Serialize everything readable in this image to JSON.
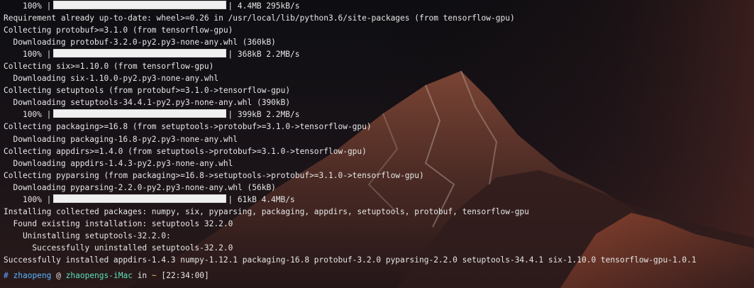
{
  "terminal": {
    "colors": {
      "background": "#101012",
      "text": "#e6e6e6",
      "progress_bar": "#f0f0f0"
    },
    "lines": [
      {
        "kind": "progress",
        "percent": "100%",
        "fill": 1.0,
        "info": "4.4MB 295kB/s"
      },
      {
        "kind": "text",
        "text": "Requirement already up-to-date: wheel>=0.26 in /usr/local/lib/python3.6/site-packages (from tensorflow-gpu)"
      },
      {
        "kind": "text",
        "text": "Collecting protobuf>=3.1.0 (from tensorflow-gpu)"
      },
      {
        "kind": "text",
        "text": "  Downloading protobuf-3.2.0-py2.py3-none-any.whl (360kB)"
      },
      {
        "kind": "progress",
        "percent": "100%",
        "fill": 1.0,
        "info": "368kB 2.2MB/s"
      },
      {
        "kind": "text",
        "text": "Collecting six>=1.10.0 (from tensorflow-gpu)"
      },
      {
        "kind": "text",
        "text": "  Downloading six-1.10.0-py2.py3-none-any.whl"
      },
      {
        "kind": "text",
        "text": "Collecting setuptools (from protobuf>=3.1.0->tensorflow-gpu)"
      },
      {
        "kind": "text",
        "text": "  Downloading setuptools-34.4.1-py2.py3-none-any.whl (390kB)"
      },
      {
        "kind": "progress",
        "percent": "100%",
        "fill": 1.0,
        "info": "399kB 2.2MB/s"
      },
      {
        "kind": "text",
        "text": "Collecting packaging>=16.8 (from setuptools->protobuf>=3.1.0->tensorflow-gpu)"
      },
      {
        "kind": "text",
        "text": "  Downloading packaging-16.8-py2.py3-none-any.whl"
      },
      {
        "kind": "text",
        "text": "Collecting appdirs>=1.4.0 (from setuptools->protobuf>=3.1.0->tensorflow-gpu)"
      },
      {
        "kind": "text",
        "text": "  Downloading appdirs-1.4.3-py2.py3-none-any.whl"
      },
      {
        "kind": "text",
        "text": "Collecting pyparsing (from packaging>=16.8->setuptools->protobuf>=3.1.0->tensorflow-gpu)"
      },
      {
        "kind": "text",
        "text": "  Downloading pyparsing-2.2.0-py2.py3-none-any.whl (56kB)"
      },
      {
        "kind": "progress",
        "percent": "100%",
        "fill": 1.0,
        "info": "61kB 4.4MB/s"
      },
      {
        "kind": "text",
        "text": "Installing collected packages: numpy, six, pyparsing, packaging, appdirs, setuptools, protobuf, tensorflow-gpu"
      },
      {
        "kind": "text",
        "text": "  Found existing installation: setuptools 32.2.0"
      },
      {
        "kind": "text",
        "text": "    Uninstalling setuptools-32.2.0:"
      },
      {
        "kind": "text",
        "text": "      Successfully uninstalled setuptools-32.2.0"
      },
      {
        "kind": "text",
        "text": "Successfully installed appdirs-1.4.3 numpy-1.12.1 packaging-16.8 protobuf-3.2.0 pyparsing-2.2.0 setuptools-34.4.1 six-1.10.0 tensorflow-gpu-1.0.1"
      }
    ],
    "prompt": {
      "hash": "#",
      "user": "zhaopeng",
      "at": "@",
      "host": "zhaopengs-iMac",
      "in": "in",
      "dir": "~",
      "time": "[22:34:00]",
      "colors": {
        "hash": "#5aa0ff",
        "user": "#59b6ff",
        "host": "#5be0b8",
        "dir": "#d9c35b"
      }
    }
  }
}
